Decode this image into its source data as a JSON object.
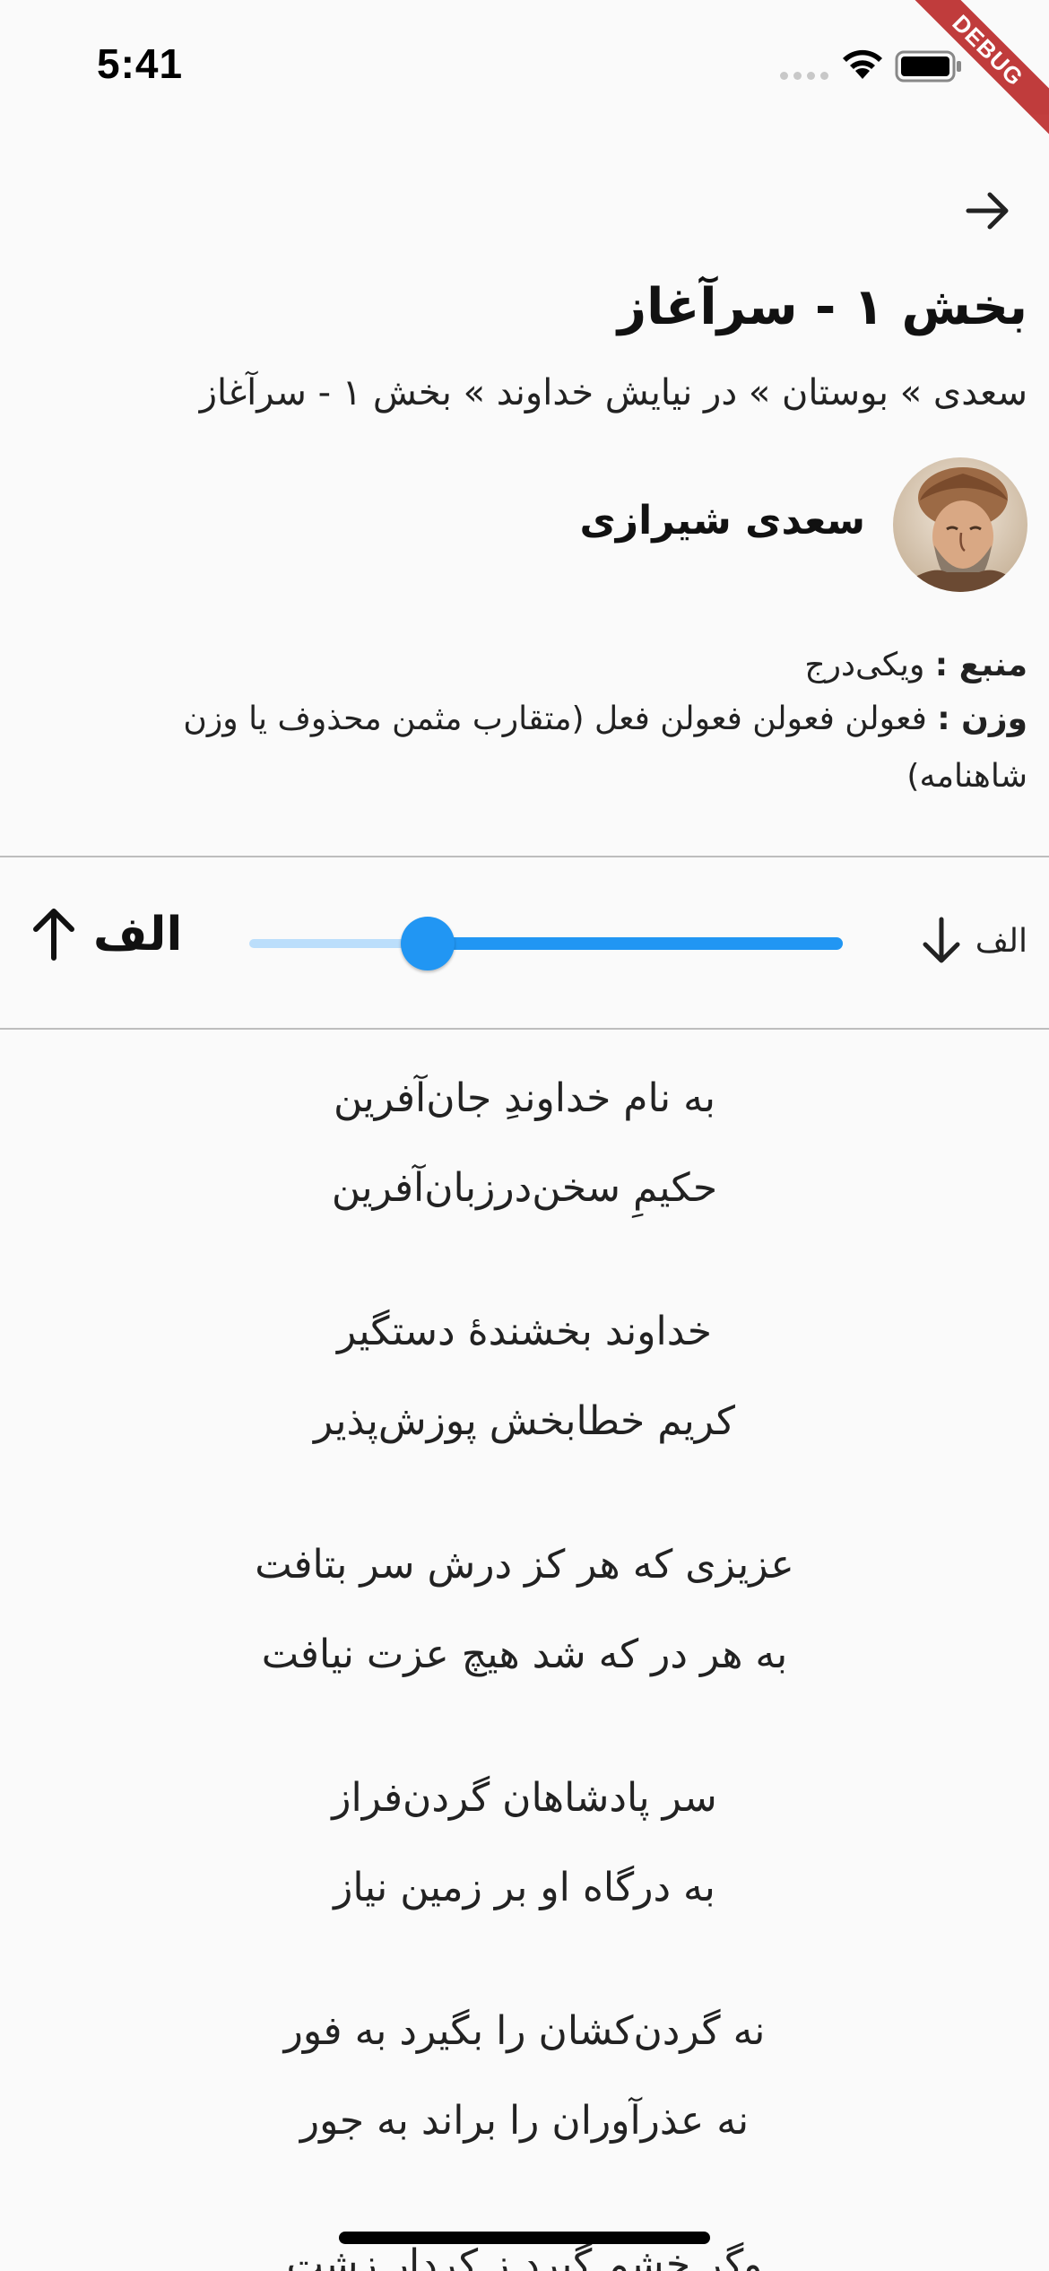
{
  "status_bar": {
    "time": "5:41"
  },
  "debug_banner": "DEBUG",
  "header": {
    "title": "بخش ۱ - سرآغاز",
    "breadcrumb": "سعدی » بوستان » در نیایش خداوند » بخش ۱ - سرآغاز",
    "poet_name": "سعدی شیرازی",
    "source_label": "منبع :",
    "source_value": "ویکی‌درج",
    "meter_label": "وزن :",
    "meter_value": "فعولن فعولن فعولن فعل (متقارب مثمن محذوف یا وزن شاهنامه)"
  },
  "font_size": {
    "small_label": "الف",
    "large_label": "الف",
    "slider_value_fraction": 0.7
  },
  "poem": {
    "couplets": [
      [
        "به نام خداوندِ جان‌آفرین",
        "حکیمِ سخن‌درزبان‌آفرین"
      ],
      [
        "خداوند بخشندهٔ دستگیر",
        "کریم خطابخش پوزش‌پذیر"
      ],
      [
        "عزیزی که هر کز درش سر بتافت",
        "به هر در که شد هیچ عزت نیافت"
      ],
      [
        "سر پادشاهان گردن‌فراز",
        "به درگاه او بر زمین نیاز"
      ],
      [
        "نه گردن‌کشان را بگیرد به فور",
        "نه عذرآوران را براند به جور"
      ],
      [
        "وگر خشم گیرد ز کردار زشت",
        ""
      ]
    ]
  },
  "colors": {
    "accent": "#2196f3",
    "accent_light": "#bbdefb",
    "background": "#fafafa",
    "debug": "#b71c1c"
  },
  "icons": {
    "back": "arrow-right-icon",
    "font_decrease": "arrow-down-icon",
    "font_increase": "arrow-up-icon"
  }
}
